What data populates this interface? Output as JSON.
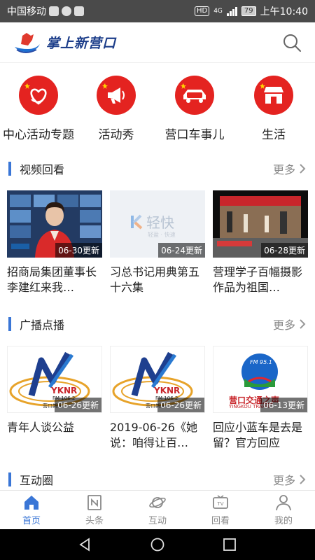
{
  "status_bar": {
    "carrier": "中国移动",
    "network": "4G",
    "hd": "HD",
    "battery": "79",
    "time": "上午10:40"
  },
  "header": {
    "logo_text": "掌上新营口",
    "search_icon": "search-icon"
  },
  "quick_nav": [
    {
      "label": "中心活动专题",
      "icon": "heart-hands-icon"
    },
    {
      "label": "活动秀",
      "icon": "megaphone-icon"
    },
    {
      "label": "营口车事儿",
      "icon": "car-icon"
    },
    {
      "label": "生活",
      "icon": "shop-icon"
    }
  ],
  "video_section": {
    "title": "视频回看",
    "more": "更多",
    "items": [
      {
        "badge": "06-30更新",
        "title": "招商局集团董事长李建红来我…"
      },
      {
        "badge": "06-24更新",
        "title": "习总书记用典第五十六集",
        "thumb_text": "轻快",
        "thumb_sub": "轻盈 · 快速"
      },
      {
        "badge": "06-28更新",
        "title": "营理学子百幅摄影作品为祖国…"
      }
    ]
  },
  "radio_section": {
    "title": "广播点播",
    "more": "更多",
    "items": [
      {
        "badge": "06-26更新",
        "title": "青年人谈公益",
        "logo": "YKNR",
        "freq": "FM 106.2",
        "org": "营口新闻"
      },
      {
        "badge": "06-26更新",
        "title": "2019-06-26《她说：咱得让百…",
        "logo": "YKNR",
        "freq": "FM 106.2",
        "org": "营口新闻"
      },
      {
        "badge": "06-13更新",
        "title": "回应小蓝车是去是留？官方回应",
        "freq": "FM 95.1",
        "logo": "营口交通之声",
        "org": "YINGKOU TRAFFIC"
      }
    ]
  },
  "interact_section": {
    "title": "互动圈",
    "more": "更多"
  },
  "tab_bar": [
    {
      "label": "首页",
      "icon": "home-icon",
      "active": true
    },
    {
      "label": "头条",
      "icon": "news-icon",
      "active": false
    },
    {
      "label": "互动",
      "icon": "planet-icon",
      "active": false
    },
    {
      "label": "回看",
      "icon": "tv-icon",
      "active": false
    },
    {
      "label": "我的",
      "icon": "user-icon",
      "active": false
    }
  ],
  "colors": {
    "accent": "#3a76d6",
    "brand_red": "#e42320"
  }
}
